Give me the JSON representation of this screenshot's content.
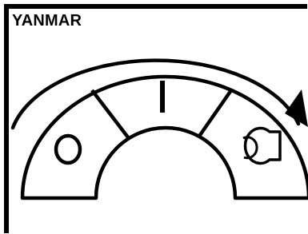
{
  "brand": {
    "name": "YANMAR"
  },
  "switch": {
    "positions": [
      {
        "name": "off",
        "symbol": "O"
      },
      {
        "name": "on",
        "symbol": "I"
      },
      {
        "name": "start",
        "symbol": "glow-plug-icon"
      }
    ],
    "rotation_direction": "clockwise"
  },
  "colors": {
    "line": "#000000",
    "background": "#ffffff"
  }
}
